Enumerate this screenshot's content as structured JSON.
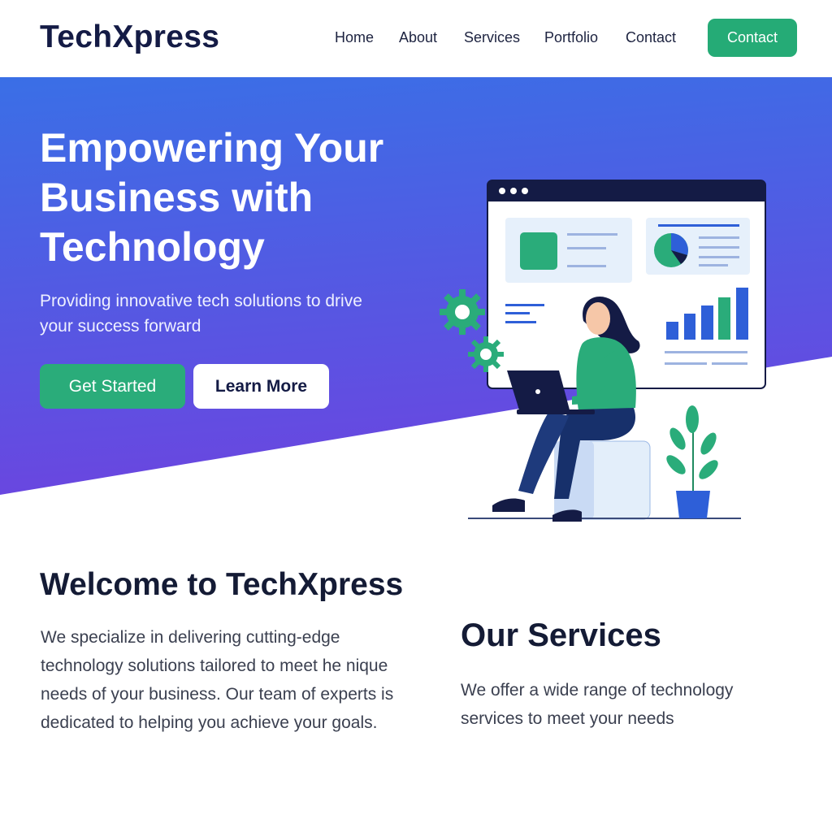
{
  "header": {
    "logo": "TechXpress",
    "nav": [
      "Home",
      "About",
      "Services",
      "Portfolio",
      "Contact"
    ],
    "contact_button": "Contact"
  },
  "hero": {
    "title": "Empowering Your Business with Technology",
    "subtitle": "Providing innovative tech solutions to drive your success forward",
    "primary_button": "Get Started",
    "secondary_button": "Learn More",
    "illustration": "person-with-laptop-dashboard-illustration"
  },
  "welcome": {
    "title": "Welcome to TechXpress",
    "text": "We specialize in delivering cutting-edge technology solutions tailored to meet he nique needs of your business. Our team of experts is dedicated to helping you achieve your goals."
  },
  "services": {
    "title": "Our Services",
    "text": "We offer a wide range of technology services to meet your needs"
  },
  "colors": {
    "accent_green": "#2aac7a",
    "hero_gradient_top": "#3a6fe6",
    "hero_gradient_bottom": "#6a46e0",
    "dark_navy": "#141b45"
  }
}
